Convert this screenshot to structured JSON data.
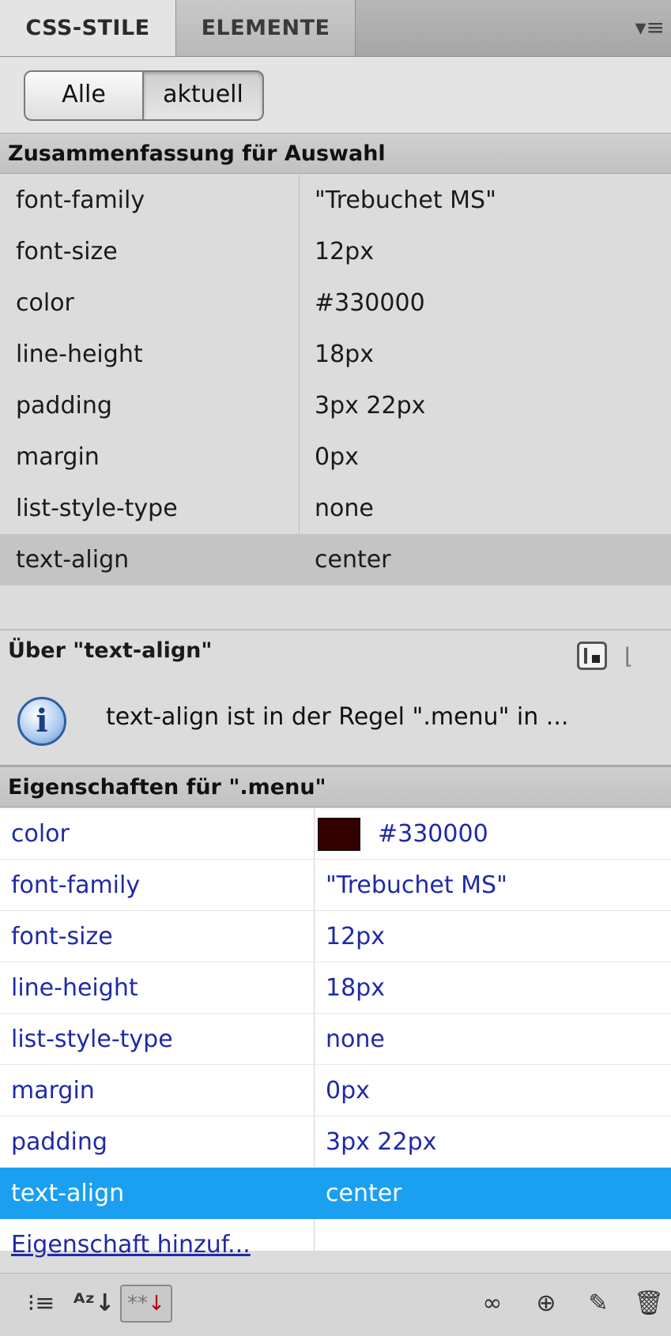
{
  "tabs": [
    {
      "label": "CSS-STILE"
    },
    {
      "label": "ELEMENTE"
    }
  ],
  "panel_menu_icon": "▾≡",
  "toggle": {
    "all": "Alle",
    "current": "aktuell",
    "selected": "aktuell"
  },
  "summary": {
    "title": "Zusammenfassung für Auswahl",
    "rows": [
      {
        "key": "font-family",
        "value": "\"Trebuchet MS\""
      },
      {
        "key": "font-size",
        "value": "12px"
      },
      {
        "key": "color",
        "value": "#330000"
      },
      {
        "key": "line-height",
        "value": "18px"
      },
      {
        "key": "padding",
        "value": "3px 22px"
      },
      {
        "key": "margin",
        "value": "0px"
      },
      {
        "key": "list-style-type",
        "value": "none"
      },
      {
        "key": "text-align",
        "value": "center"
      }
    ],
    "selected_key": "text-align"
  },
  "about": {
    "title": "Über \"text-align\"",
    "text": "text-align ist in der Regel \".menu\" in ..."
  },
  "properties": {
    "title": "Eigenschaften für \".menu\"",
    "rows": [
      {
        "key": "color",
        "value": "#330000",
        "swatch": "#330000"
      },
      {
        "key": "font-family",
        "value": "\"Trebuchet MS\""
      },
      {
        "key": "font-size",
        "value": "12px"
      },
      {
        "key": "line-height",
        "value": "18px"
      },
      {
        "key": "list-style-type",
        "value": "none"
      },
      {
        "key": "margin",
        "value": "0px"
      },
      {
        "key": "padding",
        "value": "3px 22px"
      },
      {
        "key": "text-align",
        "value": "center"
      }
    ],
    "selected_key": "text-align",
    "add_link": "Eigenschaft hinzuf..."
  },
  "toolbar": {
    "category_icon": "⁝≡",
    "az_icon": "ᴬᶻ↓",
    "set_icon": "**",
    "set_arrow": "↓",
    "link_icon": "∞",
    "new_icon": "⊕",
    "edit_icon": "✎",
    "delete_icon": "🗑"
  },
  "colors": {
    "selection_blue": "#1b9ff0",
    "property_text": "#1f2aa6",
    "swatch": "#330000"
  }
}
